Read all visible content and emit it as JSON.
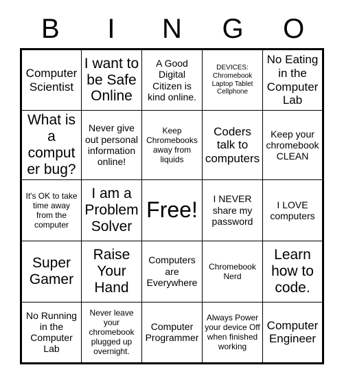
{
  "card": {
    "header_letters": [
      "B",
      "I",
      "N",
      "G",
      "O"
    ],
    "rows": [
      [
        {
          "text": "Computer Scientist",
          "size": "fs-lg"
        },
        {
          "text": "I want to be Safe Online",
          "size": "fs-xl"
        },
        {
          "text": "A Good Digital Citizen is kind online.",
          "size": "fs-md"
        },
        {
          "text": "DEVICES: Chromebook Laptop Tablet Cellphone",
          "size": "fs-xs"
        },
        {
          "text": "No Eating in the Computer Lab",
          "size": "fs-lg"
        }
      ],
      [
        {
          "text": "What is a computer bug?",
          "size": "fs-xl"
        },
        {
          "text": "Never give out personal information online!",
          "size": "fs-md"
        },
        {
          "text": "Keep Chromebooks away from liquids",
          "size": "fs-sm"
        },
        {
          "text": "Coders talk to computers",
          "size": "fs-lg"
        },
        {
          "text": "Keep your chromebook CLEAN",
          "size": "fs-md"
        }
      ],
      [
        {
          "text": "It's OK to take time away from the computer",
          "size": "fs-sm"
        },
        {
          "text": "I am a Problem Solver",
          "size": "fs-xl"
        },
        {
          "text": "Free!",
          "size": "fs-free"
        },
        {
          "text": "I NEVER share my password",
          "size": "fs-md"
        },
        {
          "text": "I LOVE computers",
          "size": "fs-md"
        }
      ],
      [
        {
          "text": "Super Gamer",
          "size": "fs-xl"
        },
        {
          "text": "Raise Your Hand",
          "size": "fs-xl"
        },
        {
          "text": "Computers are Everywhere",
          "size": "fs-md"
        },
        {
          "text": "Chromebook Nerd",
          "size": "fs-sm"
        },
        {
          "text": "Learn how to code.",
          "size": "fs-xl"
        }
      ],
      [
        {
          "text": "No Running in the Computer Lab",
          "size": "fs-md"
        },
        {
          "text": "Never leave your chromebook plugged up overnight.",
          "size": "fs-sm"
        },
        {
          "text": "Computer Programmer",
          "size": "fs-md"
        },
        {
          "text": "Always Power your device Off when finished working",
          "size": "fs-sm"
        },
        {
          "text": "Computer Engineer",
          "size": "fs-lg"
        }
      ]
    ]
  }
}
